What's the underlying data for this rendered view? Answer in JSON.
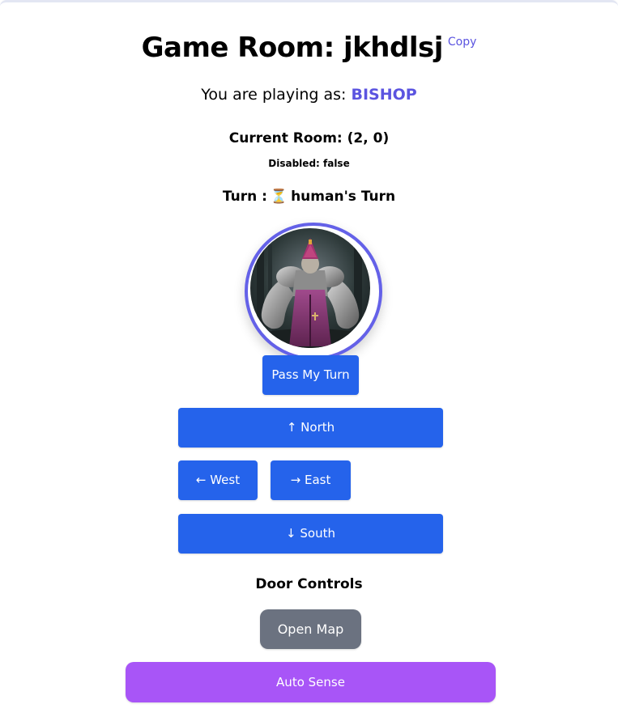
{
  "header": {
    "title": "Game Room: jkhdlsj",
    "copy_label": "Copy"
  },
  "player": {
    "prefix": "You are playing as:",
    "role": "BISHOP"
  },
  "status": {
    "current_room": "Current Room: (2, 0)",
    "disabled": "Disabled: false",
    "turn_prefix": "Turn :",
    "turn_icon": "⏳",
    "turn_text": "human's Turn"
  },
  "avatar": {
    "icon": "bishop-character-portrait"
  },
  "controls": {
    "pass_turn": "Pass My Turn",
    "north": "↑ North",
    "west": "← West",
    "east": "→ East",
    "south": "↓ South"
  },
  "doors": {
    "title": "Door Controls",
    "open_map": "Open Map",
    "auto_sense": "Auto Sense"
  },
  "colors": {
    "accent": "#5b54e0",
    "primary_button": "#2563eb",
    "map_button": "#6b7280",
    "sense_button": "#a855f7"
  }
}
